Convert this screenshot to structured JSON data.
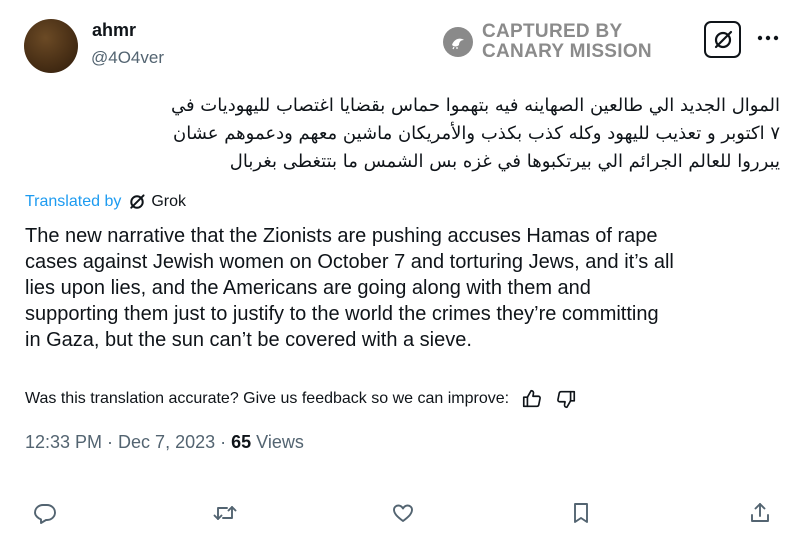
{
  "author": {
    "display_name": "ahmr",
    "handle": "@4O4ver"
  },
  "watermark": {
    "line1": "CAPTURED BY",
    "line2": "CANARY MISSION",
    "icon": "canary-bird-icon"
  },
  "header_actions": {
    "grok_icon": "grok-icon",
    "more_icon": "more-icon"
  },
  "tweet": {
    "arabic_lines": [
      "الموال الجديد الي طالعين الصهاينه فيه بتهموا حماس بقضايا اغتصاب لليهوديات في",
      "٧ اكتوبر و تعذيب لليهود وكله كذب بكذب والأمريكان ماشين معهم ودعموهم عشان",
      "يبرروا للعالم الجرائم الي بيرتكبوها في غزه بس الشمس ما بتتغطى بغربال"
    ],
    "translated_by": "Translated by",
    "translator": "Grok",
    "translation_lines": [
      "The new narrative that the Zionists are pushing accuses Hamas of rape",
      "cases against Jewish women on October 7 and torturing Jews, and it’s all",
      "lies upon lies, and the Americans are going along with them and",
      "supporting them just to justify to the world the crimes they’re committing",
      "in Gaza, but the sun can’t be covered with a sieve."
    ]
  },
  "feedback": {
    "prompt": "Was this translation accurate? Give us feedback so we can improve:",
    "icons": [
      "thumbs-up-icon",
      "thumbs-down-icon"
    ]
  },
  "meta": {
    "time": "12:33 PM",
    "separator": " · ",
    "date": "Dec 7, 2023",
    "views_count": "65",
    "views_label": " Views"
  },
  "action_bar": [
    "reply-icon",
    "retweet-icon",
    "like-icon",
    "bookmark-icon",
    "share-icon"
  ],
  "colors": {
    "text": "#0f1419",
    "secondary": "#536471",
    "link": "#1d9bf0",
    "watermark": "#8b8b8b"
  }
}
